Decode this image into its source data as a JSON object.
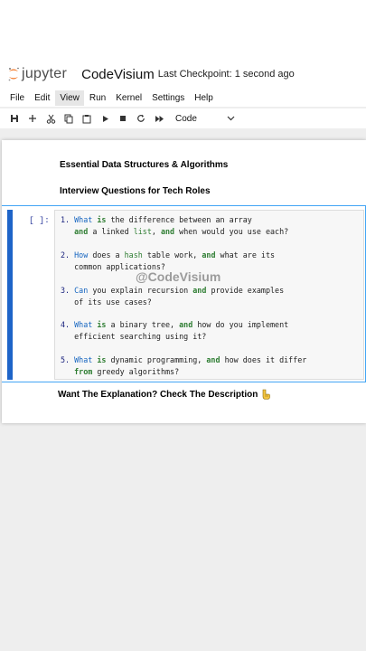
{
  "app": {
    "logo_text": "jupyter",
    "notebook_title": "CodeVisium",
    "checkpoint": "Last Checkpoint: 1 second ago"
  },
  "menu": [
    "File",
    "Edit",
    "View",
    "Run",
    "Kernel",
    "Settings",
    "Help"
  ],
  "menu_active": "View",
  "toolbar": {
    "cell_type": "Code",
    "icons": [
      "save-icon",
      "add-icon",
      "cut-icon",
      "copy-icon",
      "paste-icon",
      "run-icon",
      "stop-icon",
      "restart-icon",
      "fast-forward-icon",
      "chevron-down-icon"
    ]
  },
  "markdown": {
    "title": "Essential Data Structures & Algorithms",
    "subtitle": "Interview Questions for Tech Roles"
  },
  "code_cell": {
    "prompt": "[ ]:",
    "questions": [
      {
        "num": "1.",
        "line1": [
          [
            "kw-blue",
            "What"
          ],
          [
            "",
            "  "
          ],
          [
            "kw-green",
            "is"
          ],
          [
            "",
            " the difference between an array"
          ]
        ],
        "line2": [
          [
            "kw-green",
            "and"
          ],
          [
            "",
            " a linked "
          ],
          [
            "nm-green",
            "list"
          ],
          [
            "",
            ", "
          ],
          [
            "kw-green",
            "and"
          ],
          [
            "",
            " when would you use each?"
          ]
        ]
      }
    ],
    "lines": [
      "1. What is the difference between an array",
      "   and a linked list, and when would you use each?",
      "2. How does a hash table work, and what are its",
      "   common applications?",
      "3. Can you explain recursion and provide examples",
      "   of its use cases?",
      "4. What is a binary tree, and how do you implement",
      "   efficient searching using it?",
      "5. What is dynamic programming, and how does it differ",
      "   from greedy algorithms?"
    ]
  },
  "watermark": "@CodeVisium",
  "cta": "Want The Explanation? Check The Description"
}
